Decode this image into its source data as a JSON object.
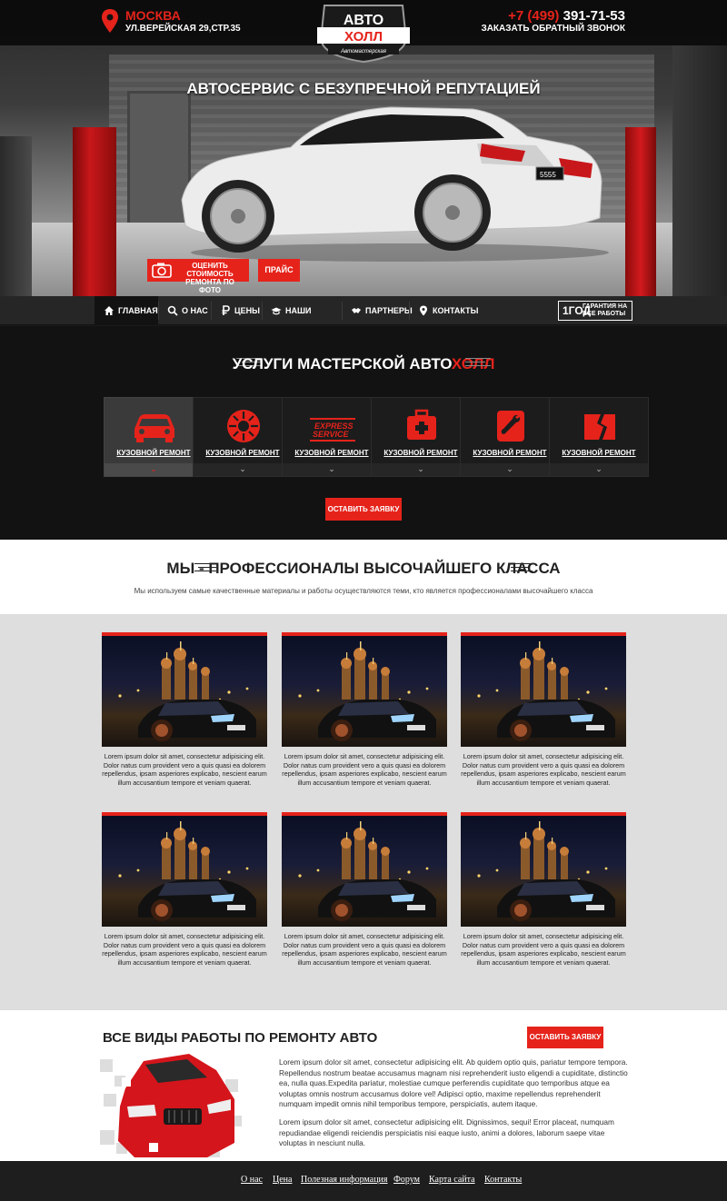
{
  "header": {
    "city": "МОСКВА",
    "address": "УЛ.ВЕРЕЙСКАЯ 29,СТР.35",
    "phone_code": "+7 (499)",
    "phone_number": "391-71-53",
    "callback": "ЗАКАЗАТЬ ОБРАТНЫЙ ЗВОНОК",
    "logo_top": "АВТО",
    "logo_bottom": "ХОЛЛ",
    "logo_sub": "Автомастерская"
  },
  "hero": {
    "title": "АВТОСЕРВИС С БЕЗУПРЕЧНОЙ РЕПУТАЦИЕЙ",
    "photo_button": "ОЦЕНИТЬ СТОИМОСТЬ РЕМОНТА ПО ФОТО",
    "price_button": "ПРАЙС",
    "plate": "5555"
  },
  "nav": {
    "items": [
      {
        "label": "ГЛАВНАЯ",
        "icon": "home-icon"
      },
      {
        "label": "О НАС",
        "icon": "search-icon"
      },
      {
        "label": "ЦЕНЫ",
        "icon": "ruble-icon"
      },
      {
        "label": "НАШИ РАБОТЫ",
        "icon": "cap-icon"
      },
      {
        "label": "ПАРТНЕРЫ",
        "icon": "handshake-icon"
      },
      {
        "label": "КОНТАКТЫ",
        "icon": "pin-icon"
      }
    ],
    "guarantee_big": "1год",
    "guarantee_small": "ГАРАНТИЯ НА ВСЕ РАБОТЫ"
  },
  "services": {
    "title_prefix": "УСЛУГИ МАСТЕРСКОЙ АВТО",
    "title_accent": "ХОЛЛ",
    "items": [
      {
        "label": "КУЗОВНОЙ РЕМОНТ",
        "icon": "car-icon"
      },
      {
        "label": "КУЗОВНОЙ РЕМОНТ",
        "icon": "brake-disc-icon"
      },
      {
        "label": "КУЗОВНОЙ РЕМОНТ",
        "icon": "express-service-icon"
      },
      {
        "label": "КУЗОВНОЙ РЕМОНТ",
        "icon": "first-aid-icon"
      },
      {
        "label": "КУЗОВНОЙ РЕМОНТ",
        "icon": "wrench-icon"
      },
      {
        "label": "КУЗОВНОЙ РЕМОНТ",
        "icon": "broken-glass-icon"
      }
    ],
    "express_line1": "EXPRESS",
    "express_line2": "SERVICE",
    "order_button": "ОСТАВИТЬ ЗАЯВКУ"
  },
  "pro": {
    "title": "МЫ - ПРОФЕССИОНАЛЫ ВЫСОЧАЙШЕГО КЛАССА",
    "subtitle": "Мы используем самые качественные материалы и работы осуществляются теми, кто является профессионалами высочайшего класса"
  },
  "gallery": {
    "card_text": "Lorem ipsum dolor sit amet, consectetur adipisicing elit. Dolor natus cum provident vero a quis quasi ea dolorem repellendus, ipsam asperiores explicabo, nescient earum illum accusantium tempore et veniam quaerat."
  },
  "repair": {
    "title": "ВСЕ ВИДЫ РАБОТЫ ПО РЕМОНТУ АВТО",
    "order_button": "ОСТАВИТЬ ЗАЯВКУ",
    "p1": "Lorem ipsum dolor sit amet, consectetur adipisicing elit. Ab quidem optio quis, pariatur tempore tempora. Repellendus nostrum beatae accusamus magnam nisi reprehenderit iusto eligendi a cupiditate, distinctio ea, nulla quas.Expedita pariatur, molestiae cumque perferendis cupiditate quo temporibus atque ea voluptas omnis nostrum accusamus dolore vel! Adipisci optio, maxime repellendus reprehenderit numquam impedit omnis nihil temporibus tempore, perspiciatis, autem itaque.",
    "p2": "Lorem ipsum dolor sit amet, consectetur adipisicing elit. Dignissimos, sequi! Error placeat, numquam repudiandae eligendi reiciendis perspiciatis nisi eaque iusto, animi a dolores, laborum saepe vitae voluptas in nesciunt nulla."
  },
  "footer": {
    "links": [
      "О нас",
      "Цена",
      "Полезная информация",
      "Форум",
      "Карта сайта",
      "Контакты"
    ]
  },
  "colors": {
    "accent": "#e5231b",
    "dark": "#121212",
    "gray_bg": "#dedede"
  }
}
